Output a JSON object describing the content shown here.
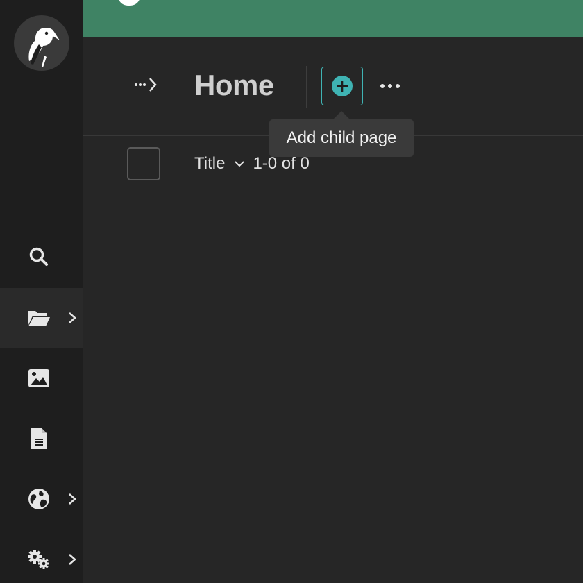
{
  "header": {
    "title": "Home",
    "add_child_tooltip": "Add child page"
  },
  "table": {
    "title_column": "Title",
    "count": "1-0 of 0"
  },
  "sidebar": {
    "items": [
      {
        "icon": "search-icon"
      },
      {
        "icon": "folder-open-icon",
        "active": true,
        "has_chevron": true
      },
      {
        "icon": "image-icon"
      },
      {
        "icon": "document-icon"
      },
      {
        "icon": "globe-icon",
        "has_chevron": true
      },
      {
        "icon": "cogs-icon",
        "has_chevron": true
      }
    ]
  },
  "colors": {
    "banner": "#3f8364",
    "accent": "#3fb3b3",
    "background": "#262626",
    "sidebar": "#1e1e1e"
  }
}
